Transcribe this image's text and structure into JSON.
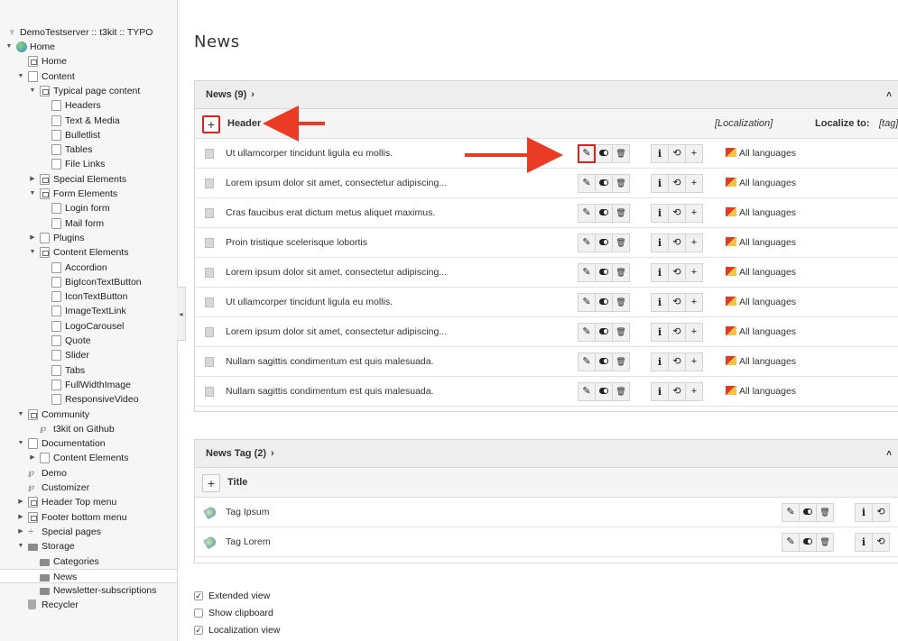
{
  "tree": {
    "root_label": "DemoTestserver :: t3kit :: TYPO",
    "items": [
      {
        "label": "Home",
        "icon": "globe-icon"
      },
      {
        "label": "Home",
        "icon": "shortcut-page-icon"
      },
      {
        "label": "Content",
        "icon": "page-icon"
      },
      {
        "label": "Typical page content",
        "icon": "shortcut-page-icon"
      },
      {
        "label": "Headers",
        "icon": "page-icon"
      },
      {
        "label": "Text & Media",
        "icon": "page-icon"
      },
      {
        "label": "Bulletlist",
        "icon": "page-icon"
      },
      {
        "label": "Tables",
        "icon": "page-icon"
      },
      {
        "label": "File Links",
        "icon": "page-icon"
      },
      {
        "label": "Special Elements",
        "icon": "shortcut-page-icon"
      },
      {
        "label": "Form Elements",
        "icon": "shortcut-page-icon"
      },
      {
        "label": "Login form",
        "icon": "page-icon"
      },
      {
        "label": "Mail form",
        "icon": "page-icon"
      },
      {
        "label": "Plugins",
        "icon": "page-icon"
      },
      {
        "label": "Content Elements",
        "icon": "shortcut-page-icon"
      },
      {
        "label": "Accordion",
        "icon": "page-icon"
      },
      {
        "label": "BigIconTextButton",
        "icon": "page-icon"
      },
      {
        "label": "IconTextButton",
        "icon": "page-icon"
      },
      {
        "label": "ImageTextLink",
        "icon": "page-icon"
      },
      {
        "label": "LogoCarousel",
        "icon": "page-icon"
      },
      {
        "label": "Quote",
        "icon": "page-icon"
      },
      {
        "label": "Slider",
        "icon": "page-icon"
      },
      {
        "label": "Tabs",
        "icon": "page-icon"
      },
      {
        "label": "FullWidthImage",
        "icon": "page-icon"
      },
      {
        "label": "ResponsiveVideo",
        "icon": "page-icon"
      },
      {
        "label": "Community",
        "icon": "shortcut-page-icon"
      },
      {
        "label": "t3kit on Github",
        "icon": "link-icon"
      },
      {
        "label": "Documentation",
        "icon": "page-icon"
      },
      {
        "label": "Content Elements",
        "icon": "page-icon"
      },
      {
        "label": "Demo",
        "icon": "link-icon"
      },
      {
        "label": "Customizer",
        "icon": "link-icon"
      },
      {
        "label": "Header Top menu",
        "icon": "shortcut-page-icon"
      },
      {
        "label": "Footer bottom menu",
        "icon": "shortcut-page-icon"
      },
      {
        "label": "Special pages",
        "icon": "separator-icon"
      },
      {
        "label": "Storage",
        "icon": "folder-icon"
      },
      {
        "label": "Categories",
        "icon": "folder-icon"
      },
      {
        "label": "News",
        "icon": "folder-icon"
      },
      {
        "label": "Newsletter-subscriptions",
        "icon": "folder-icon"
      },
      {
        "label": "Recycler",
        "icon": "trash-icon"
      }
    ]
  },
  "page_title": "News",
  "news_panel": {
    "title": "News (9)",
    "col_header": "Header",
    "col_localization": "[Localization]",
    "col_localize_to": "Localize to:",
    "col_tag": "[tag]",
    "rows": [
      {
        "text": "Ut ullamcorper tincidunt ligula eu mollis.",
        "lang": "All languages"
      },
      {
        "text": "Lorem ipsum dolor sit amet, consectetur adipiscing...",
        "lang": "All languages"
      },
      {
        "text": "Cras faucibus erat dictum metus aliquet maximus.",
        "lang": "All languages"
      },
      {
        "text": "Proin tristique scelerisque lobortis",
        "lang": "All languages"
      },
      {
        "text": "Lorem ipsum dolor sit amet, consectetur adipiscing...",
        "lang": "All languages"
      },
      {
        "text": "Ut ullamcorper tincidunt ligula eu mollis.",
        "lang": "All languages"
      },
      {
        "text": "Lorem ipsum dolor sit amet, consectetur adipiscing...",
        "lang": "All languages"
      },
      {
        "text": "Nullam sagittis condimentum est quis malesuada.",
        "lang": "All languages"
      },
      {
        "text": "Nullam sagittis condimentum est quis malesuada.",
        "lang": "All languages"
      }
    ]
  },
  "tag_panel": {
    "title": "News Tag (2)",
    "col_title": "Title",
    "rows": [
      {
        "text": "Tag Ipsum"
      },
      {
        "text": "Tag Lorem"
      }
    ]
  },
  "glyphs": {
    "chevron": "›",
    "caret": "˄",
    "plus": "+",
    "edit": "✎",
    "delete": "🗑",
    "info": "i",
    "history": "⟲",
    "check": "✓",
    "collapse": "◂",
    "root": "♆"
  },
  "options": [
    {
      "label": "Extended view",
      "checked": true
    },
    {
      "label": "Show clipboard",
      "checked": false
    },
    {
      "label": "Localization view",
      "checked": true
    }
  ],
  "colors": {
    "highlight": "#e0201a",
    "arrow": "#ea3b25"
  }
}
